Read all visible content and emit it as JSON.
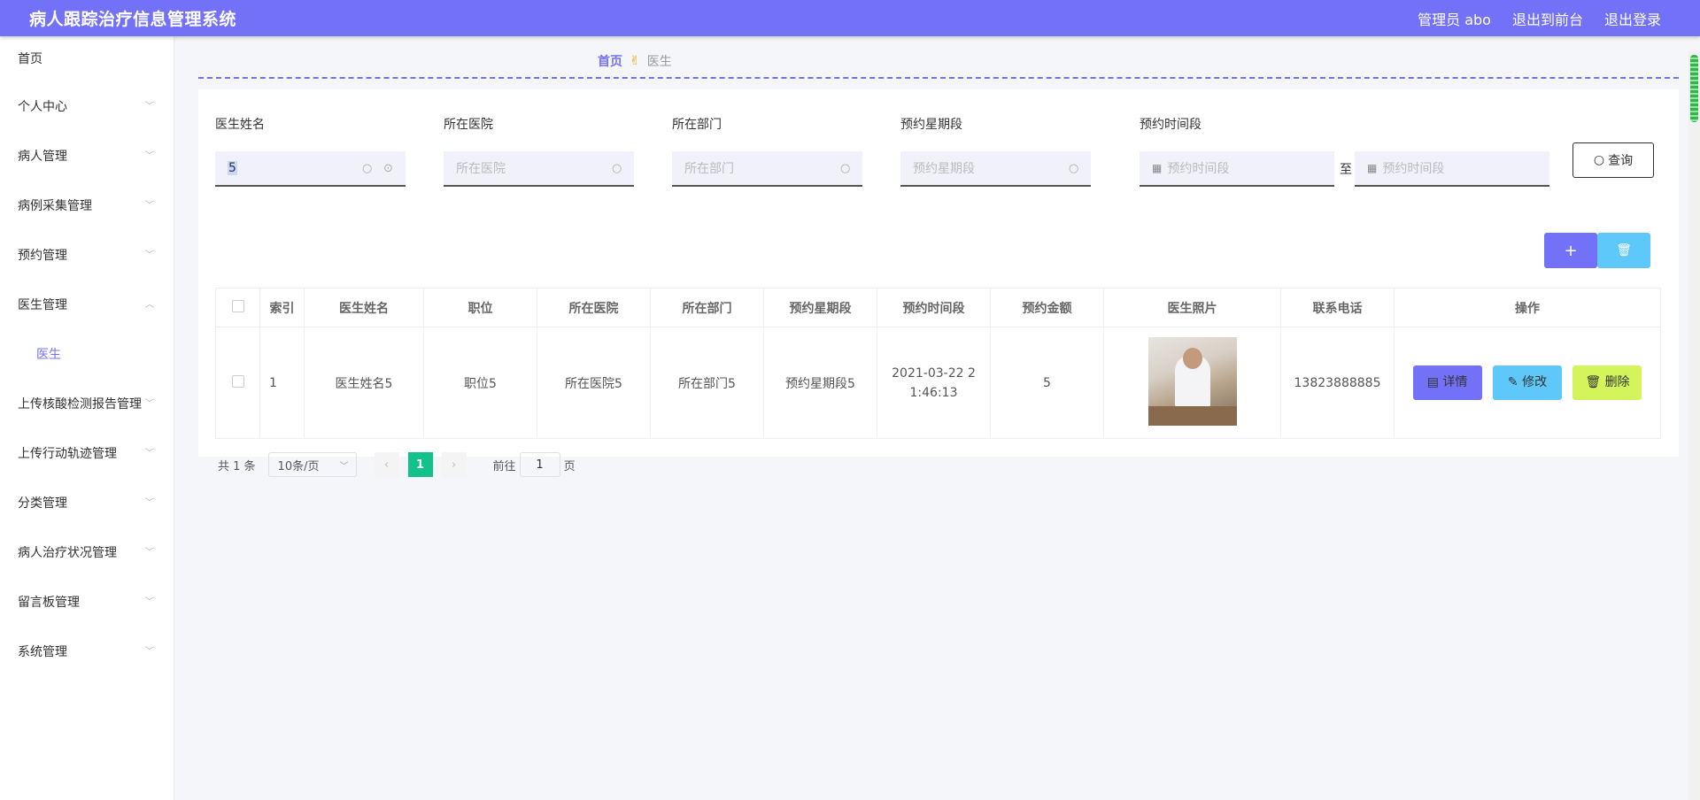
{
  "header": {
    "title": "病人跟踪治疗信息管理系统",
    "user": "管理员 abo",
    "to_front": "退出到前台",
    "logout": "退出登录"
  },
  "sidebar": {
    "items": [
      {
        "label": "首页"
      },
      {
        "label": "个人中心"
      },
      {
        "label": "病人管理"
      },
      {
        "label": "病例采集管理"
      },
      {
        "label": "预约管理"
      },
      {
        "label": "医生管理"
      },
      {
        "label": "医生"
      },
      {
        "label": "上传核酸检测报告管理"
      },
      {
        "label": "上传行动轨迹管理"
      },
      {
        "label": "分类管理"
      },
      {
        "label": "病人治疗状况管理"
      },
      {
        "label": "留言板管理"
      },
      {
        "label": "系统管理"
      }
    ]
  },
  "breadcrumb": {
    "home": "首页",
    "current": "医生"
  },
  "search": {
    "doctor_name": {
      "label": "医生姓名",
      "value": "5"
    },
    "hospital": {
      "label": "所在医院",
      "placeholder": "所在医院"
    },
    "department": {
      "label": "所在部门",
      "placeholder": "所在部门"
    },
    "weekday": {
      "label": "预约星期段",
      "placeholder": "预约星期段"
    },
    "time_range": {
      "label": "预约时间段",
      "start_placeholder": "预约时间段",
      "separator": "至",
      "end_placeholder": "预约时间段"
    },
    "query_label": "查询"
  },
  "toolbar": {
    "add": "+",
    "delete": "🗑"
  },
  "table": {
    "columns": [
      "索引",
      "医生姓名",
      "职位",
      "所在医院",
      "所在部门",
      "预约星期段",
      "预约时间段",
      "预约金额",
      "医生照片",
      "联系电话",
      "操作"
    ],
    "rows": [
      {
        "index": "1",
        "name": "医生姓名5",
        "position": "职位5",
        "hospital": "所在医院5",
        "department": "所在部门5",
        "weekday": "预约星期段5",
        "time": "2021-03-22 21:46:13",
        "amount": "5",
        "phone": "13823888885",
        "actions": {
          "detail": "详情",
          "edit": "修改",
          "delete": "删除"
        }
      }
    ]
  },
  "pager": {
    "total": "共 1 条",
    "page_size": "10条/页",
    "current": "1",
    "goto_prefix": "前往",
    "goto_value": "1",
    "goto_suffix": "页"
  }
}
